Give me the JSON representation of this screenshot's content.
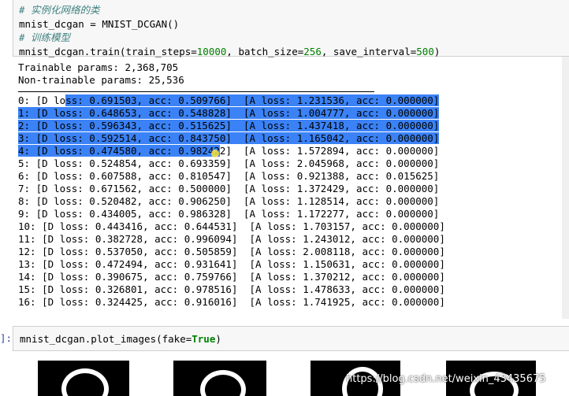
{
  "code_cell": {
    "comment1": "# 实例化网络的类",
    "line2_a": "mnist_dcgan = MNIST_DCGAN()",
    "comment2": "# 训练模型",
    "line4_a": "mnist_dcgan.train(train_steps=",
    "train_steps": "10000",
    "line4_b": ", batch_size=",
    "batch_size": "256",
    "line4_c": ", save_interval=",
    "save_interval": "500",
    "line4_d": ")"
  },
  "output": {
    "trainable": "Trainable params: 2,368,705",
    "non_trainable": "Non-trainable params: 25,536",
    "log_lines": [
      "0: [D loss: 0.691503, acc: 0.509766]  [A loss: 1.231536, acc: 0.000000]",
      "1: [D loss: 0.648653, acc: 0.548828]  [A loss: 1.004777, acc: 0.000000]",
      "2: [D loss: 0.596343, acc: 0.515625]  [A loss: 1.437418, acc: 0.000000]",
      "3: [D loss: 0.592514, acc: 0.843750]  [A loss: 1.165042, acc: 0.000000]",
      "4: [D loss: 0.474580, acc: 0.982422]  [A loss: 1.572894, acc: 0.000000]",
      "5: [D loss: 0.524854, acc: 0.693359]  [A loss: 2.045968, acc: 0.000000]",
      "6: [D loss: 0.607588, acc: 0.810547]  [A loss: 0.921388, acc: 0.015625]",
      "7: [D loss: 0.671562, acc: 0.500000]  [A loss: 1.372429, acc: 0.000000]",
      "8: [D loss: 0.520482, acc: 0.906250]  [A loss: 1.128514, acc: 0.000000]",
      "9: [D loss: 0.434005, acc: 0.986328]  [A loss: 1.172277, acc: 0.000000]",
      "10: [D loss: 0.443416, acc: 0.644531]  [A loss: 1.703157, acc: 0.000000]",
      "11: [D loss: 0.382728, acc: 0.996094]  [A loss: 1.243012, acc: 0.000000]",
      "12: [D loss: 0.537050, acc: 0.505859]  [A loss: 2.008118, acc: 0.000000]",
      "13: [D loss: 0.472494, acc: 0.931641]  [A loss: 1.150631, acc: 0.000000]",
      "14: [D loss: 0.390675, acc: 0.759766]  [A loss: 1.370212, acc: 0.000000]",
      "15: [D loss: 0.326801, acc: 0.978516]  [A loss: 1.478633, acc: 0.000000]",
      "16: [D loss: 0.324425, acc: 0.916016]  [A loss: 1.741925, acc: 0.000000]"
    ]
  },
  "cell2": {
    "prompt": "]:",
    "code_a": "mnist_dcgan.plot_images(fake=",
    "code_kw": "True",
    "code_b": ")"
  },
  "watermark": "https://blog.csdn.net/weixin_43435675"
}
